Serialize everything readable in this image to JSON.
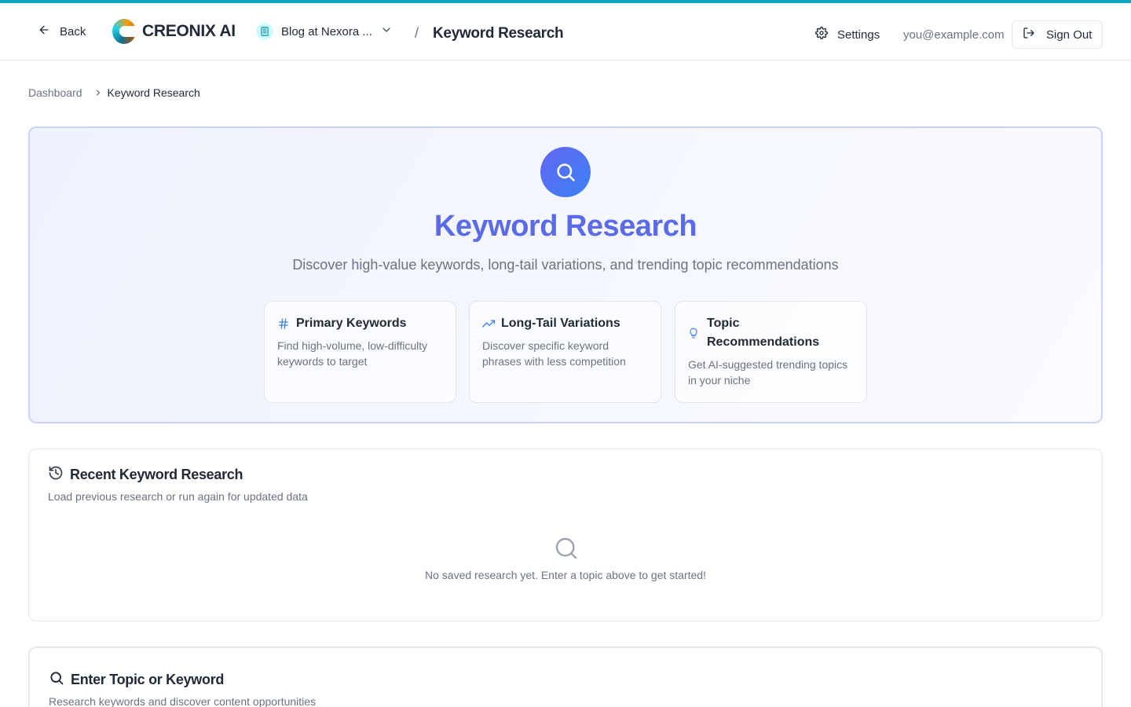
{
  "header": {
    "back_label": "Back",
    "brand": "CREONIX AI",
    "blog_selector": "Blog at Nexora ...",
    "separator": "/",
    "page_title": "Keyword Research",
    "settings_label": "Settings",
    "user_email": "you@example.com",
    "signout_label": "Sign Out"
  },
  "breadcrumb": {
    "root": "Dashboard",
    "current": "Keyword Research"
  },
  "hero": {
    "title": "Keyword Research",
    "subtitle": "Discover high-value keywords, long-tail variations, and trending topic recommendations",
    "features": [
      {
        "icon": "hash-icon",
        "title": "Primary Keywords",
        "description": "Find high-volume, low-difficulty keywords to target"
      },
      {
        "icon": "trending-up-icon",
        "title": "Long-Tail Variations",
        "description": "Discover specific keyword phrases with less competition"
      },
      {
        "icon": "lightbulb-icon",
        "title": "Topic Recommendations",
        "description": "Get AI-suggested trending topics in your niche"
      }
    ]
  },
  "recent": {
    "title": "Recent Keyword Research",
    "subtitle": "Load previous research or run again for updated data",
    "empty_text": "No saved research yet. Enter a topic above to get started!"
  },
  "topic_input": {
    "title": "Enter Topic or Keyword",
    "subtitle": "Research keywords and discover content opportunities"
  },
  "colors": {
    "accent": "#0ea5c6",
    "primary": "#5b6ae6",
    "hero_border": "#c7d2fe"
  }
}
